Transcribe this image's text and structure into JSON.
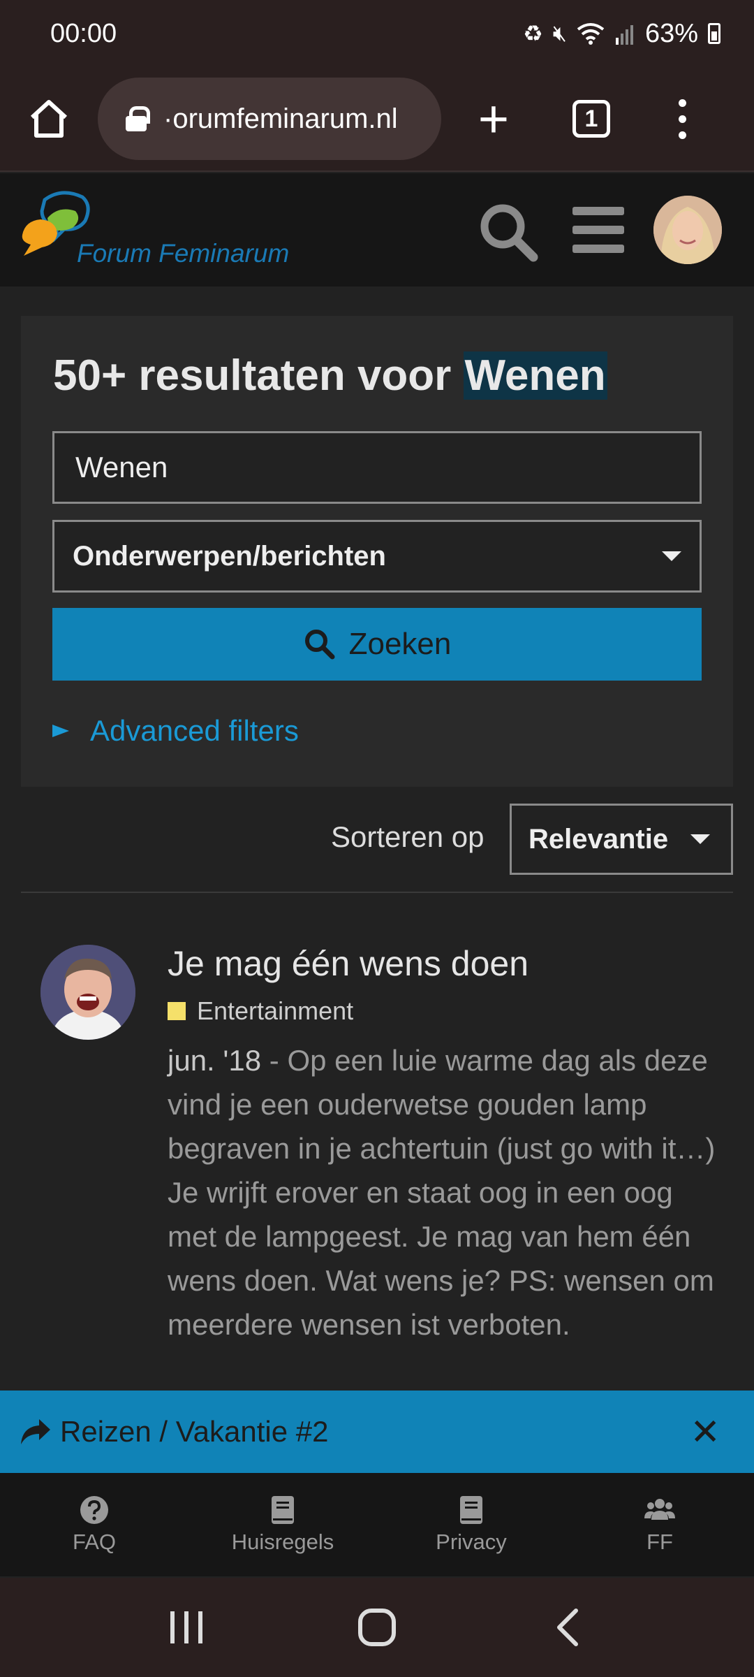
{
  "status_bar": {
    "time": "00:00",
    "battery": "63%"
  },
  "browser": {
    "url": "·orumfeminarum.nl",
    "tab_count": "1"
  },
  "site": {
    "logo_text": "Forum Feminarum"
  },
  "search": {
    "title_prefix": "50+ resultaten voor ",
    "title_query": "Wenen",
    "query_value": "Wenen",
    "type_selected": "Onderwerpen/berichten",
    "submit_label": "Zoeken",
    "advanced_filters_label": "Advanced filters"
  },
  "sort": {
    "label": "Sorteren op",
    "selected": "Relevantie"
  },
  "results": [
    {
      "title": "Je mag één wens doen",
      "category": "Entertainment",
      "category_color": "#f5e06a",
      "date": "jun. '18",
      "snippet": " - Op een luie warme dag als deze vind je een ouderwetse gouden lamp begraven in je achtertuin (just go with it…) Je wrijft erover en staat oog in een oog met de lampgeest. Je mag van hem één wens doen. Wat wens je? PS: wensen om meerdere wensen ist verboten."
    }
  ],
  "thread_banner": {
    "label": "Reizen / Vakantie #2"
  },
  "footer": {
    "items": [
      {
        "label": "FAQ",
        "icon": "question-circle-icon"
      },
      {
        "label": "Huisregels",
        "icon": "book-icon"
      },
      {
        "label": "Privacy",
        "icon": "book-icon"
      },
      {
        "label": "FF",
        "icon": "users-icon"
      }
    ]
  },
  "colors": {
    "accent": "#1083b7",
    "link": "#1a9ad6",
    "highlight": "#0e3446"
  }
}
